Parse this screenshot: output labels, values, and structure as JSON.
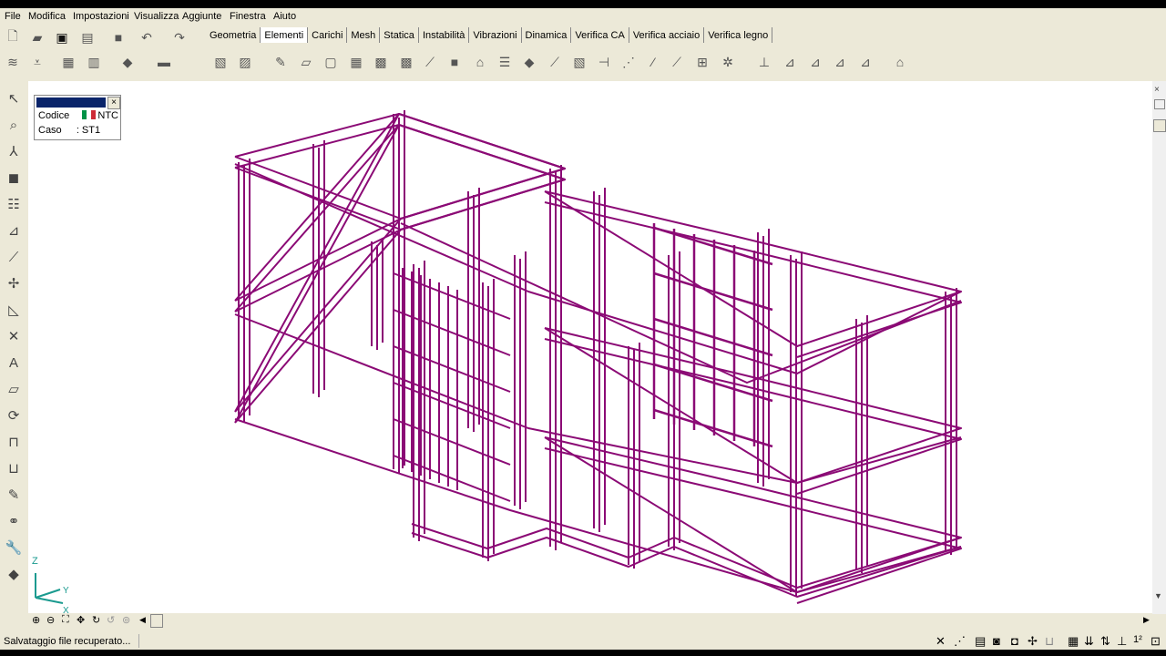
{
  "menu": [
    "File",
    "Modifica",
    "Impostazioni",
    "Visualizza",
    "Aggiunte",
    "Finestra",
    "Aiuto"
  ],
  "tabs": [
    {
      "label": "Geometria",
      "active": false
    },
    {
      "label": "Elementi",
      "active": true
    },
    {
      "label": "Carichi",
      "active": false
    },
    {
      "label": "Mesh",
      "active": false
    },
    {
      "label": "Statica",
      "active": false
    },
    {
      "label": "Instabilità",
      "active": false
    },
    {
      "label": "Vibrazioni",
      "active": false
    },
    {
      "label": "Dinamica",
      "active": false
    },
    {
      "label": "Verifica CA",
      "active": false
    },
    {
      "label": "Verifica acciaio",
      "active": false
    },
    {
      "label": "Verifica legno",
      "active": false
    }
  ],
  "info_panel": {
    "codice_label": "Codice",
    "codice_value": "NTC",
    "caso_label": "Caso",
    "caso_value": ": ST1"
  },
  "axes": {
    "z": "Z",
    "y": "Y",
    "x": "X"
  },
  "status": {
    "message": "Salvataggio file recuperato..."
  },
  "colors": {
    "model": "#8b0a75",
    "axes": "#1a9a8f",
    "selection": "#0a246a"
  },
  "icons": {
    "toolbar_top": [
      "new-file-icon",
      "open-folder-icon",
      "save-icon",
      "print-icon",
      "box-icon",
      "undo-icon",
      "redo-icon"
    ],
    "toolbar_bottom": [
      "layers-icon",
      "level-icon",
      "table-icon",
      "grid-icon",
      "layer-stack-icon",
      "camera-icon"
    ],
    "left_tools": [
      "select-arrow-icon",
      "zoom-icon",
      "axes-icon",
      "view-icon",
      "list-icon",
      "ruler-icon",
      "line-icon",
      "node-icon",
      "measure-icon",
      "cross-icon",
      "text-icon",
      "shape-icon",
      "rotate-icon",
      "bracket-icon",
      "link-icon",
      "pen-icon",
      "glasses-icon",
      "wrench-icon",
      "info-icon"
    ]
  }
}
